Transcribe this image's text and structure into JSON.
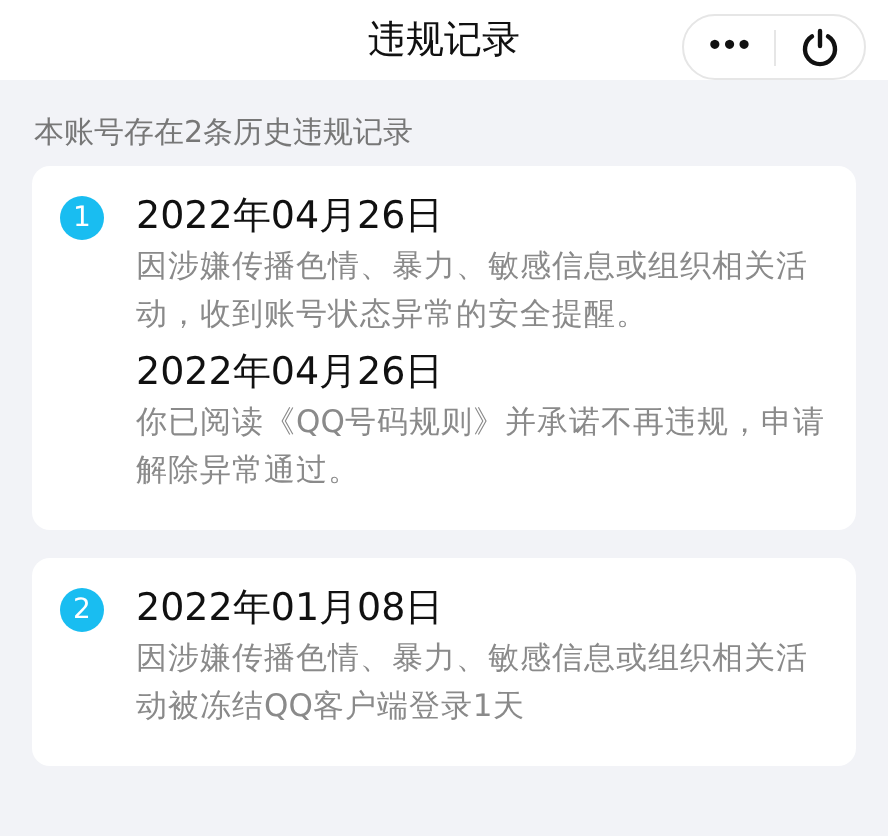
{
  "header": {
    "title": "违规记录",
    "more_button": "•••"
  },
  "summary": "本账号存在2条历史违规记录",
  "records": [
    {
      "index": "1",
      "events": [
        {
          "date": "2022年04月26日",
          "text": "因涉嫌传播色情、暴力、敏感信息或组织相关活动，收到账号状态异常的安全提醒。"
        },
        {
          "date": "2022年04月26日",
          "text": "你已阅读《QQ号码规则》并承诺不再违规，申请解除异常通过。"
        }
      ]
    },
    {
      "index": "2",
      "events": [
        {
          "date": "2022年01月08日",
          "text": "因涉嫌传播色情、暴力、敏感信息或组织相关活动被冻结QQ客户端登录1天"
        }
      ]
    }
  ]
}
